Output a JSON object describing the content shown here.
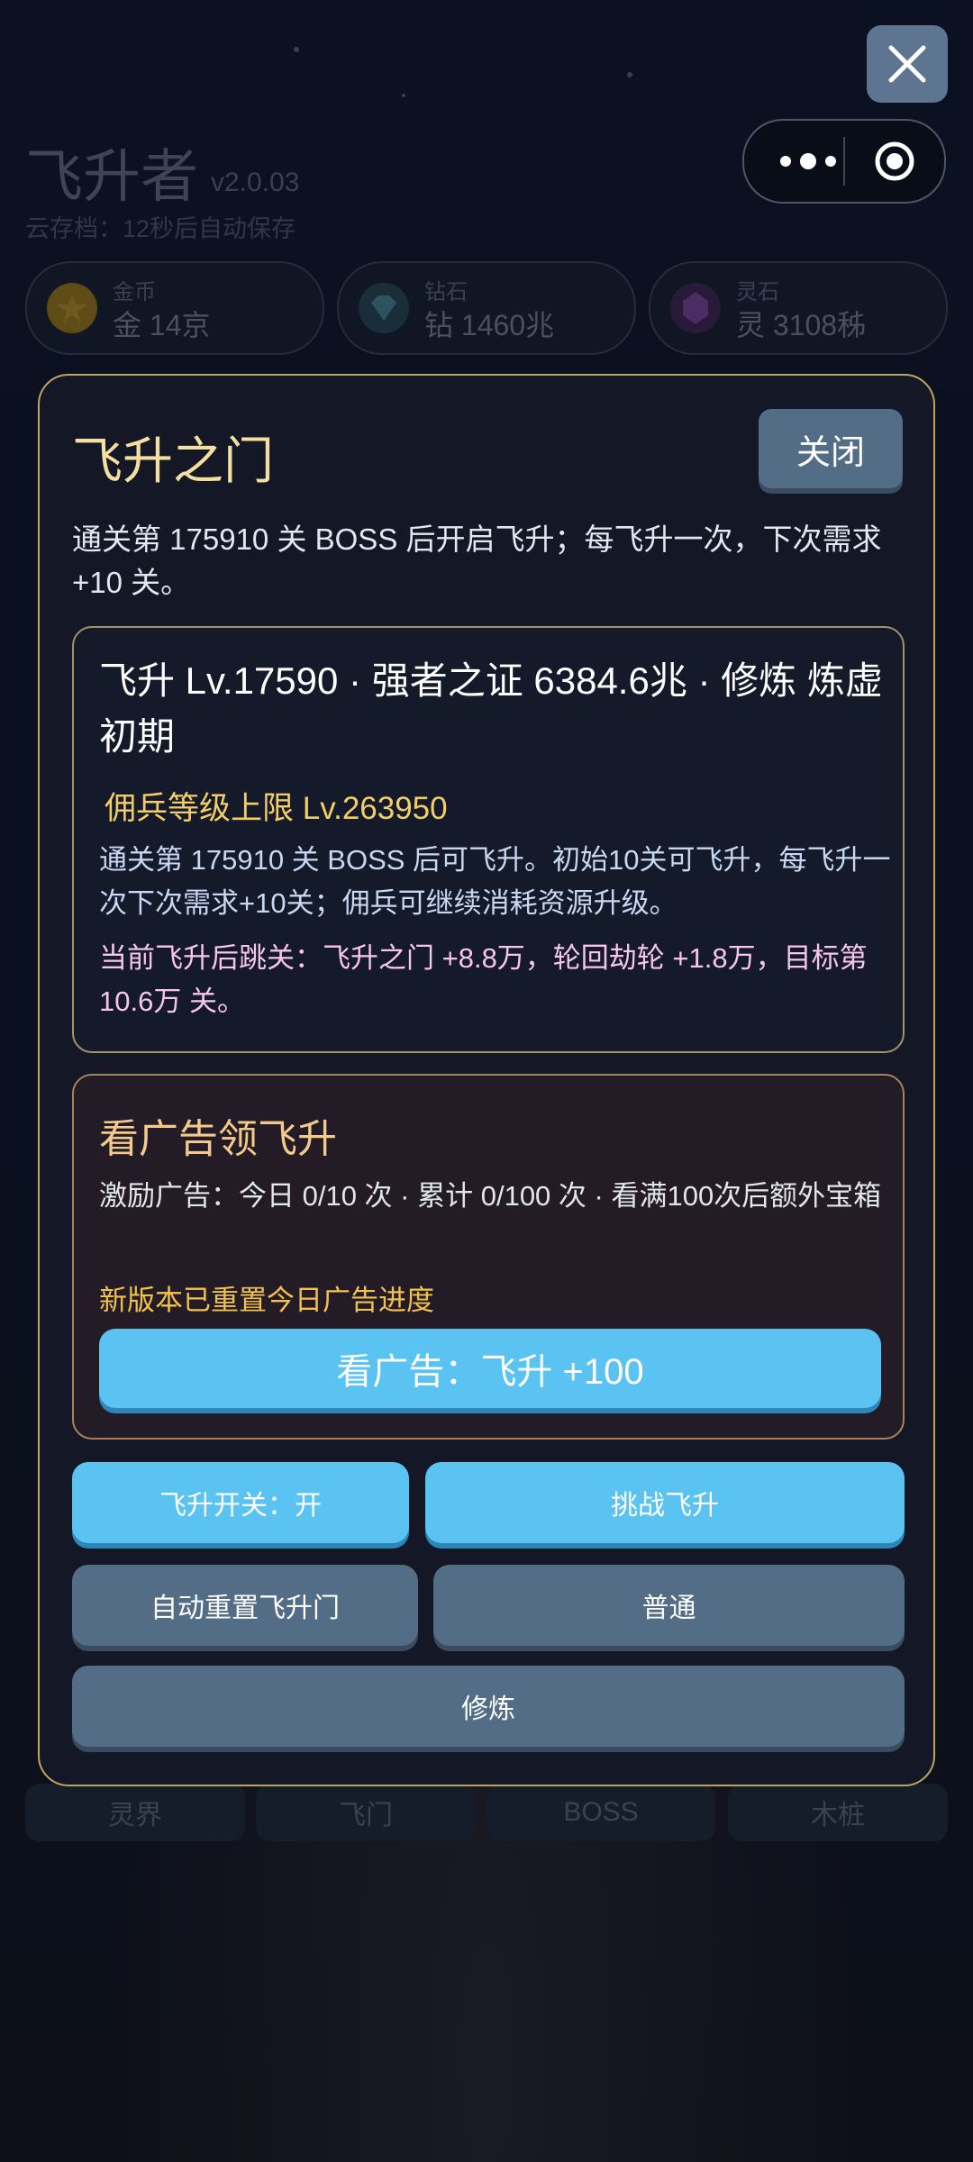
{
  "game": {
    "title": "飞升者",
    "version": "v2.0.03",
    "cloud_save": "云存档：12秒后自动保存",
    "resources": [
      {
        "label": "金币",
        "value": "金 14京",
        "icon": "gold-coin-icon"
      },
      {
        "label": "钻石",
        "value": "钻 1460兆",
        "icon": "diamond-icon"
      },
      {
        "label": "灵石",
        "value": "灵 3108秭",
        "icon": "spirit-stone-icon"
      }
    ],
    "bottom_tabs": [
      "灵界",
      "飞门",
      "BOSS",
      "木桩"
    ]
  },
  "modal": {
    "title": "飞升之门",
    "close_label": "关闭",
    "description": "通关第 175910 关 BOSS 后开启飞升；每飞升一次，下次需求 +10 关。",
    "info": {
      "main": "飞升 Lv.17590 · 强者之证 6384.6兆 · 修炼 炼虚初期",
      "mercenary_cap": "佣兵等级上限 Lv.263950",
      "rule": "通关第 175910 关 BOSS 后可飞升。初始10关可飞升，每飞升一次下次需求+10关；佣兵可继续消耗资源升级。",
      "jump": "当前飞升后跳关：飞升之门 +8.8万，轮回劫轮 +1.8万，目标第 10.6万 关。"
    },
    "ad": {
      "title": "看广告领飞升",
      "progress": "激励广告：今日 0/10 次 · 累计 0/100 次 · 看满100次后额外宝箱",
      "reset_notice": "新版本已重置今日广告进度",
      "button_label": "看广告：飞升 +100"
    },
    "buttons": {
      "toggle": "飞升开关：开",
      "challenge": "挑战飞升",
      "auto_reset": "自动重置飞升门",
      "mode": "普通",
      "cultivate": "修炼"
    }
  },
  "colors": {
    "gold_border": "#bfa460",
    "blue_button": "#5ac3f2",
    "gray_button": "#546d87",
    "modal_bg": "#141826"
  }
}
